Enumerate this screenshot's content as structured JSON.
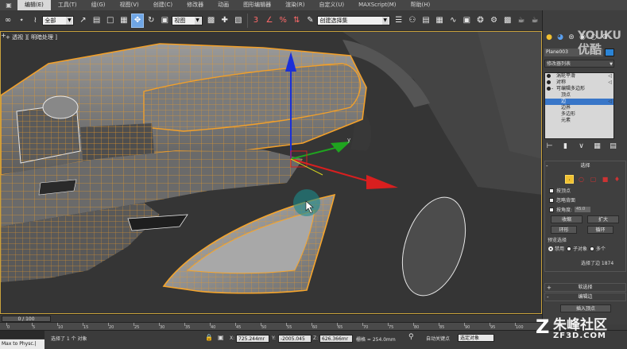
{
  "app": {
    "logo_glyph": "▣"
  },
  "menu": {
    "items": [
      {
        "label": "编辑(E)",
        "active": true
      },
      {
        "label": "工具(T)",
        "active": false
      },
      {
        "label": "组(G)",
        "active": false
      },
      {
        "label": "视图(V)",
        "active": false
      },
      {
        "label": "创建(C)",
        "active": false
      },
      {
        "label": "修改器",
        "active": false
      },
      {
        "label": "动画",
        "active": false
      },
      {
        "label": "图形编辑器",
        "active": false
      },
      {
        "label": "渲染(R)",
        "active": false
      },
      {
        "label": "自定义(U)",
        "active": false
      },
      {
        "label": "MAXScript(M)",
        "active": false
      },
      {
        "label": "帮助(H)",
        "active": false
      }
    ]
  },
  "toolbar": {
    "filter_select": "全部",
    "refcoord_select": "视图",
    "named_selection": "创建选择集",
    "icons": [
      "link-icon",
      "unlink-icon",
      "bind-icon",
      "select-icon",
      "select-by-name-icon",
      "rect-region-icon",
      "window-crossing-icon",
      "move-icon",
      "rotate-icon",
      "scale-icon"
    ]
  },
  "viewport": {
    "label": "+ 透视 ][ 明暗处理 ]",
    "close_glyph": "+",
    "colors": {
      "wire": "#e89a2a",
      "mesh": "#8a8a8a",
      "axis_x": "#d81f1f",
      "axis_y": "#1fa51f",
      "axis_z": "#1b2fd8"
    }
  },
  "watermark": {
    "youku_top": "YOUKU",
    "youku_bottom": "优酷",
    "site_cn": "朱峰社区",
    "site_en": "ZF3D.COM",
    "z_mark": "Z"
  },
  "panel": {
    "tab_icons": [
      "create-tab-icon",
      "modify-tab-icon",
      "hierarchy-tab-icon",
      "motion-tab-icon",
      "display-tab-icon",
      "utilities-tab-icon"
    ],
    "object_name": "Plane003",
    "object_color": "#2b84d6",
    "modifier_list_label": "修改器列表",
    "stack": [
      {
        "label": "涡轮平滑",
        "level": 0,
        "selected": false
      },
      {
        "label": "对称",
        "level": 0,
        "selected": false
      },
      {
        "label": "可编辑多边形",
        "level": 0,
        "selected": false
      },
      {
        "label": "顶点",
        "level": 1,
        "selected": false
      },
      {
        "label": "边",
        "level": 1,
        "selected": true
      },
      {
        "label": "边界",
        "level": 1,
        "selected": false
      },
      {
        "label": "多边形",
        "level": 1,
        "selected": false
      },
      {
        "label": "元素",
        "level": 1,
        "selected": false
      }
    ],
    "selection": {
      "title": "选择",
      "by_vertex": "按顶点",
      "ignore_backface": "忽略背面",
      "by_angle": "按角度:",
      "angle_value": "45.0",
      "shrink": "收缩",
      "grow": "扩大",
      "ring": "环形",
      "loop": "循环",
      "preview_title": "预览选择",
      "preview_options": [
        "禁用",
        "子对象",
        "多个"
      ],
      "selected_text": "选择了边 1874"
    },
    "soft_selection": "软选择",
    "edit_edges": "编辑边",
    "insert_vertex": "插入顶点"
  },
  "timeline": {
    "frame_label": "0 / 100",
    "ticks": [
      "0",
      "5",
      "10",
      "15",
      "20",
      "25",
      "30",
      "35",
      "40",
      "45",
      "50",
      "55",
      "60",
      "65",
      "70",
      "75",
      "80",
      "85",
      "90",
      "95",
      "100"
    ]
  },
  "status": {
    "script_text": "Max to Physc.|",
    "selection_text": "选择了 1 个 对象",
    "x_label": "X:",
    "x_value": "725.244mr",
    "y_label": "Y:",
    "y_value": "-2005.045",
    "z_label": "Z:",
    "z_value": "626.366mr",
    "grid_text": "栅格 = 254.0mm",
    "auto_key": "自动关键点",
    "key_mode_select": "选定对象"
  }
}
